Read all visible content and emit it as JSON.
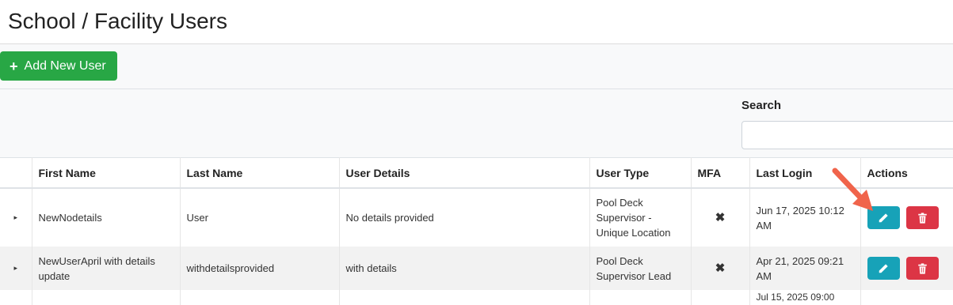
{
  "page": {
    "title": "School / Facility Users"
  },
  "toolbar": {
    "add_icon": "+",
    "add_label": "Add New User"
  },
  "search": {
    "label": "Search",
    "placeholder": ""
  },
  "table": {
    "headers": [
      "",
      "First Name",
      "Last Name",
      "User Details",
      "User Type",
      "MFA",
      "Last Login",
      "Actions"
    ],
    "rows": [
      {
        "expand": "▸",
        "first_name": "NewNodetails",
        "last_name": "User",
        "details": "No details provided",
        "user_type": "Pool Deck Supervisor - Unique Location",
        "mfa": "✖",
        "last_login": "Jun 17, 2025 10:12 AM"
      },
      {
        "expand": "▸",
        "first_name": "NewUserApril with details update",
        "last_name": "withdetailsprovided",
        "details": "with details",
        "user_type": "Pool Deck Supervisor Lead",
        "mfa": "✖",
        "last_login": "Apr 21, 2025 09:21 AM"
      },
      {
        "last_login": "Jul 15, 2025 09:00"
      }
    ]
  },
  "colors": {
    "add_button": "#28a745",
    "edit_button": "#17a2b8",
    "delete_button": "#dc3545",
    "annotation_arrow": "#f0644b"
  },
  "icons": {
    "edit": "pencil-icon",
    "delete": "trash-icon",
    "expand": "caret-right-icon",
    "mfa_off": "x-mark-icon"
  }
}
